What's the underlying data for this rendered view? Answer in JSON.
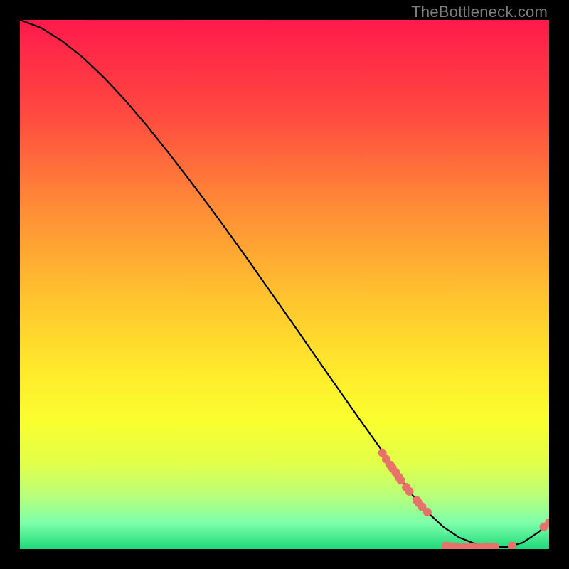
{
  "watermark": "TheBottleneck.com",
  "chart_data": {
    "type": "line",
    "title": "",
    "xlabel": "",
    "ylabel": "",
    "xlim": [
      0,
      100
    ],
    "ylim": [
      0,
      100
    ],
    "grid": false,
    "legend": false,
    "background_gradient": {
      "top": "#ff1a4b",
      "mid1": "#ff7a3a",
      "mid2": "#ffd930",
      "mid3": "#f7ff2e",
      "low1": "#d8ff66",
      "low2": "#9fff9f",
      "bottom": "#1fd97a"
    },
    "series": [
      {
        "name": "bottleneck-curve",
        "color": "#000000",
        "x": [
          0,
          4,
          8,
          12,
          16,
          20,
          24,
          28,
          32,
          36,
          40,
          44,
          48,
          52,
          56,
          60,
          64,
          68,
          71,
          74,
          77,
          80,
          83,
          86,
          89,
          92,
          95,
          98,
          100
        ],
        "y": [
          100,
          98.5,
          96.0,
          92.8,
          89.0,
          84.7,
          80.0,
          75.0,
          69.8,
          64.5,
          59.0,
          53.4,
          47.7,
          42.0,
          36.2,
          30.5,
          24.8,
          19.2,
          14.5,
          10.4,
          7.0,
          4.2,
          2.2,
          1.0,
          0.4,
          0.4,
          1.2,
          3.2,
          5.0
        ]
      }
    ],
    "points": [
      {
        "x": 68.5,
        "y": 18.2
      },
      {
        "x": 69.2,
        "y": 17.0
      },
      {
        "x": 70.0,
        "y": 15.9
      },
      {
        "x": 70.4,
        "y": 15.3
      },
      {
        "x": 71.0,
        "y": 14.5
      },
      {
        "x": 71.6,
        "y": 13.6
      },
      {
        "x": 72.0,
        "y": 13.0
      },
      {
        "x": 73.0,
        "y": 11.7
      },
      {
        "x": 73.6,
        "y": 10.9
      },
      {
        "x": 75.0,
        "y": 9.2
      },
      {
        "x": 75.4,
        "y": 8.7
      },
      {
        "x": 76.0,
        "y": 8.0
      },
      {
        "x": 77.0,
        "y": 7.0
      },
      {
        "x": 80.5,
        "y": 0.6
      },
      {
        "x": 81.2,
        "y": 0.5
      },
      {
        "x": 82.0,
        "y": 0.45
      },
      {
        "x": 82.8,
        "y": 0.4
      },
      {
        "x": 84.0,
        "y": 0.38
      },
      {
        "x": 84.8,
        "y": 0.37
      },
      {
        "x": 85.6,
        "y": 0.36
      },
      {
        "x": 86.5,
        "y": 0.36
      },
      {
        "x": 87.4,
        "y": 0.36
      },
      {
        "x": 88.2,
        "y": 0.37
      },
      {
        "x": 89.0,
        "y": 0.38
      },
      {
        "x": 89.8,
        "y": 0.4
      },
      {
        "x": 93.0,
        "y": 0.6
      },
      {
        "x": 99.0,
        "y": 4.2
      },
      {
        "x": 100.0,
        "y": 5.0
      }
    ],
    "point_style": {
      "color": "#e77269",
      "radius": 6
    }
  }
}
